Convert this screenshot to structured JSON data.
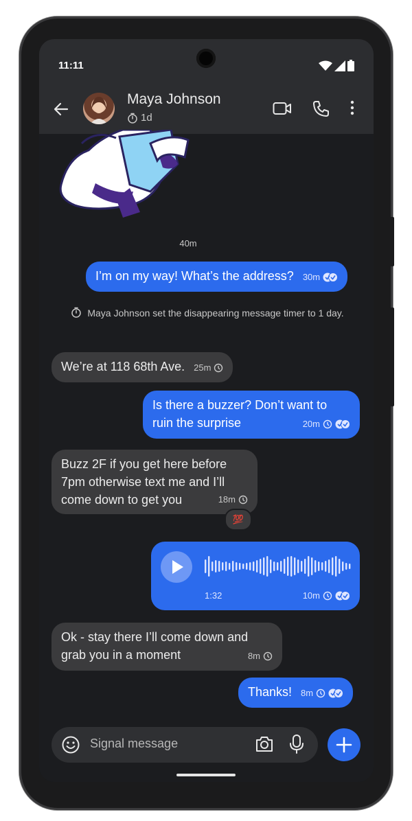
{
  "status_bar": {
    "time": "11:11"
  },
  "header": {
    "contact_name": "Maya Johnson",
    "timer_label": "1d",
    "icons": [
      "back-arrow-icon",
      "video-call-icon",
      "phone-call-icon",
      "more-vert-icon"
    ]
  },
  "chat": {
    "sticker_time": "40m",
    "messages": [
      {
        "dir": "out",
        "text": "I’m on my way! What’s the address?",
        "time": "30m"
      },
      {
        "dir": "system",
        "text": "Maya Johnson set the disappearing message timer to 1 day."
      },
      {
        "dir": "in",
        "text": "We’re at 118 68th Ave.",
        "time": "25m"
      },
      {
        "dir": "out",
        "text": "Is there a buzzer? Don’t want to ruin the surprise",
        "time": "20m"
      },
      {
        "dir": "in",
        "text": "Buzz 2F if you get here before 7pm otherwise text me and I’ll come down to get you",
        "time": "18m",
        "reaction": "💯"
      },
      {
        "dir": "out",
        "type": "voice",
        "duration": "1:32",
        "time": "10m"
      },
      {
        "dir": "in",
        "text": "Ok - stay there I’ll come down and grab you in a moment",
        "time": "8m"
      },
      {
        "dir": "out",
        "text": "Thanks!",
        "time": "8m"
      }
    ]
  },
  "composer": {
    "placeholder": "Signal message"
  },
  "colors": {
    "accent": "#2c6bed",
    "incoming": "#3b3b3d",
    "background": "#1b1c1f",
    "header": "#2c2d30"
  }
}
